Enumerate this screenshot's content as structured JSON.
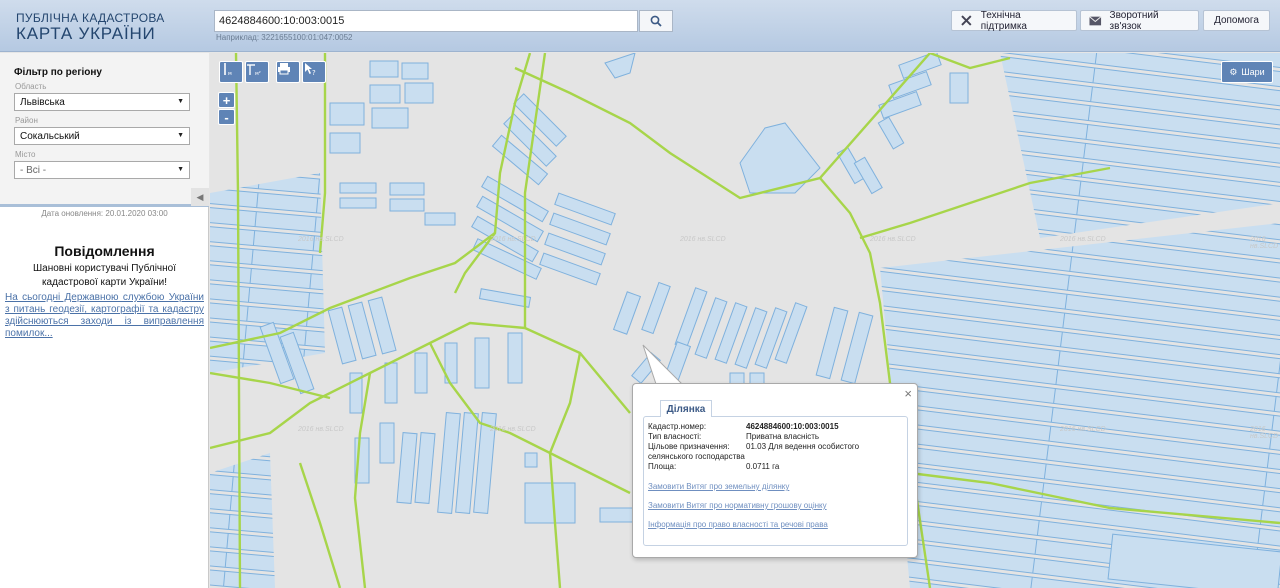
{
  "header": {
    "logo_line1": "ПУБЛІЧНА КАДАСТРОВА",
    "logo_line2": "КАРТА УКРАЇНИ",
    "search_value": "4624884600:10:003:0015",
    "search_hint": "Наприклад: 3221655100:01:047:0052",
    "support_label": "Технічна підтримка",
    "feedback_label": "Зворотний зв'язок",
    "help_label": "Допомога"
  },
  "sidebar": {
    "filter_title": "Фільтр по регіону",
    "region_label": "Область",
    "region_value": "Львівська",
    "district_label": "Район",
    "district_value": "Сокальський",
    "city_label": "Місто",
    "city_value": "- Всі -",
    "update_date": "Дата оновлення: 20.01.2020 03:00",
    "notice_title": "Повідомлення",
    "notice_text": "Шановні користувачі Публічної кадастрової карти України!",
    "notice_link": "На сьогодні Державною службою України з питань геодезії, картографії та кадастру здійснюються заходи із виправлення помилок..."
  },
  "map": {
    "watermark": "2016 нв.SLCD",
    "layers_label": "Шари",
    "zoom_in": "+",
    "zoom_out": "-",
    "icons": {
      "tool1": "ruler-icon",
      "tool2": "area-measure-icon",
      "tool3": "print-icon",
      "tool4": "identify-icon",
      "layers": "gear-icon",
      "search": "search-icon",
      "support": "tools-icon",
      "feedback": "envelope-icon"
    }
  },
  "popup": {
    "tab_label": "Ділянка",
    "close": "×",
    "cadastral_label": "Кадастр.номер:",
    "cadastral_value": "4624884600:10:003:0015",
    "ownership_label": "Тип власності:",
    "ownership_value": "Приватна власність",
    "purpose_label": "Цільове призначення:",
    "purpose_value": "01.03 Для ведення особистого",
    "purpose_value2": "селянського господарства",
    "area_label": "Площа:",
    "area_value": "0.0711 га",
    "link1": "Замовити Витяг про земельну ділянку",
    "link2": "Замовити Витяг про нормативну грошову оцінку",
    "link3": "Інформація про право власності та речові права"
  },
  "colors": {
    "header": "#c3d3e8",
    "parcel_fill": "#c9def0",
    "parcel_stroke": "#7fb1dd",
    "road": "#a7d54a",
    "button": "#5f84b6",
    "link": "#4b72a8"
  }
}
